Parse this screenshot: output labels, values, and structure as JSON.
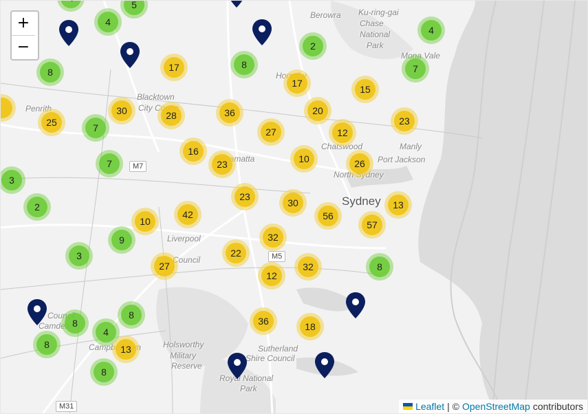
{
  "zoom": {
    "in_label": "+",
    "out_label": "−"
  },
  "labels": [
    {
      "id": "berowra",
      "text": "Berowra",
      "class": ""
    },
    {
      "id": "kuringgai",
      "text": "Ku-ring-gai",
      "class": ""
    },
    {
      "id": "kuringgai2",
      "text": "Chase",
      "class": ""
    },
    {
      "id": "kuringgai3",
      "text": "National",
      "class": ""
    },
    {
      "id": "kuringgai4",
      "text": "Park",
      "class": ""
    },
    {
      "id": "monavale",
      "text": "Mona Vale",
      "class": ""
    },
    {
      "id": "hornsby",
      "text": "Hornsby",
      "class": ""
    },
    {
      "id": "penrith",
      "text": "Penrith",
      "class": ""
    },
    {
      "id": "blacktown",
      "text": "Blacktown",
      "class": ""
    },
    {
      "id": "blacktown2",
      "text": "City Counc",
      "class": ""
    },
    {
      "id": "parramatta",
      "text": "Parramatta",
      "class": ""
    },
    {
      "id": "chatswood",
      "text": "Chatswood",
      "class": ""
    },
    {
      "id": "manly",
      "text": "Manly",
      "class": ""
    },
    {
      "id": "portjackson",
      "text": "Port Jackson",
      "class": ""
    },
    {
      "id": "northsydney",
      "text": "North Sydney",
      "class": ""
    },
    {
      "id": "sydney",
      "text": "Sydney",
      "class": "city"
    },
    {
      "id": "liverpool",
      "text": "Liverpool",
      "class": ""
    },
    {
      "id": "liverpool2",
      "text": "City Council",
      "class": ""
    },
    {
      "id": "camden",
      "text": "Camden",
      "class": ""
    },
    {
      "id": "camden2",
      "text": "Council",
      "class": ""
    },
    {
      "id": "campbelltown",
      "text": "Campbelltown",
      "class": ""
    },
    {
      "id": "holsworthy",
      "text": "Holsworthy",
      "class": ""
    },
    {
      "id": "holsworthy2",
      "text": "Military",
      "class": ""
    },
    {
      "id": "holsworthy3",
      "text": "Reserve",
      "class": ""
    },
    {
      "id": "sutherland",
      "text": "Sutherland",
      "class": ""
    },
    {
      "id": "sutherland2",
      "text": "Shire Council",
      "class": ""
    },
    {
      "id": "royal",
      "text": "Royal National",
      "class": ""
    },
    {
      "id": "royal2",
      "text": "Park",
      "class": ""
    }
  ],
  "shields": [
    {
      "id": "m7",
      "text": "M7"
    },
    {
      "id": "m5",
      "text": "M5"
    },
    {
      "id": "m31",
      "text": "M31"
    }
  ],
  "clusters": [
    {
      "count": "4",
      "color": "green"
    },
    {
      "count": "5",
      "color": "green"
    },
    {
      "count": "4",
      "color": "green"
    },
    {
      "count": "2",
      "color": "green"
    },
    {
      "count": "4",
      "color": "green"
    },
    {
      "count": "8",
      "color": "green"
    },
    {
      "count": "8",
      "color": "green"
    },
    {
      "count": "7",
      "color": "green"
    },
    {
      "count": "17",
      "color": "yellow"
    },
    {
      "count": "17",
      "color": "yellow"
    },
    {
      "count": "15",
      "color": "yellow"
    },
    {
      "count": "30",
      "color": "yellow"
    },
    {
      "count": "28",
      "color": "yellow"
    },
    {
      "count": "36",
      "color": "yellow"
    },
    {
      "count": "20",
      "color": "yellow"
    },
    {
      "count": "25",
      "color": "yellow"
    },
    {
      "count": "7",
      "color": "green"
    },
    {
      "count": "27",
      "color": "yellow"
    },
    {
      "count": "12",
      "color": "yellow"
    },
    {
      "count": "23",
      "color": "yellow"
    },
    {
      "count": "16",
      "color": "yellow"
    },
    {
      "count": "23",
      "color": "yellow"
    },
    {
      "count": "10",
      "color": "yellow"
    },
    {
      "count": "26",
      "color": "yellow"
    },
    {
      "count": "7",
      "color": "green"
    },
    {
      "count": "3",
      "color": "green"
    },
    {
      "count": "23",
      "color": "yellow"
    },
    {
      "count": "30",
      "color": "yellow"
    },
    {
      "count": "13",
      "color": "yellow"
    },
    {
      "count": "2",
      "color": "green"
    },
    {
      "count": "42",
      "color": "yellow"
    },
    {
      "count": "56",
      "color": "yellow"
    },
    {
      "count": "10",
      "color": "yellow"
    },
    {
      "count": "57",
      "color": "yellow"
    },
    {
      "count": "9",
      "color": "green"
    },
    {
      "count": "32",
      "color": "yellow"
    },
    {
      "count": "3",
      "color": "green"
    },
    {
      "count": "22",
      "color": "yellow"
    },
    {
      "count": "27",
      "color": "yellow"
    },
    {
      "count": "32",
      "color": "yellow"
    },
    {
      "count": "8",
      "color": "green"
    },
    {
      "count": "12",
      "color": "yellow"
    },
    {
      "count": "8",
      "color": "green"
    },
    {
      "count": "8",
      "color": "green"
    },
    {
      "count": "36",
      "color": "yellow"
    },
    {
      "count": "4",
      "color": "green"
    },
    {
      "count": "18",
      "color": "yellow"
    },
    {
      "count": "8",
      "color": "green"
    },
    {
      "count": "13",
      "color": "yellow"
    },
    {
      "count": "8",
      "color": "green"
    },
    {
      "count": "",
      "color": "yellow"
    }
  ],
  "pins": [
    {},
    {},
    {},
    {},
    {},
    {},
    {},
    {}
  ],
  "pin_color": "#0b1f5e",
  "attribution": {
    "leaflet": "Leaflet",
    "sep": "| ©",
    "osm": "OpenStreetMap",
    "suffix": "contributors"
  }
}
